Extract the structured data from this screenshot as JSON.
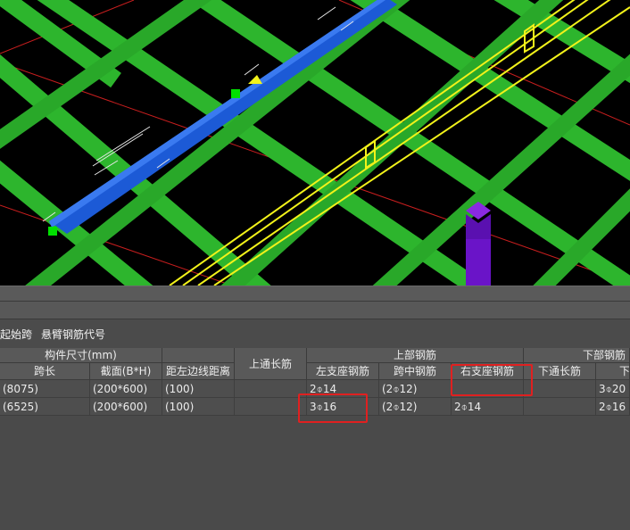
{
  "toolbar": {
    "start_span": "起始跨",
    "cantilever_code": "悬臂钢筋代号"
  },
  "table": {
    "group_member_size": "构件尺寸(mm)",
    "col_span": "跨长",
    "col_section": "截面(B*H)",
    "col_offset": "距左边线距离",
    "col_top_through": "上通长筋",
    "group_top": "上部钢筋",
    "col_left_support": "左支座钢筋",
    "col_mid_span": "跨中钢筋",
    "col_right_support": "右支座钢筋",
    "group_bottom": "下部钢筋",
    "col_bottom_through": "下通长筋",
    "col_bottom_next": "下",
    "rows": [
      {
        "span": "(8075)",
        "section": "(200*600)",
        "offset": "(100)",
        "top_through": "",
        "left_support": "2⌽14",
        "mid_span": "(2⌽12)",
        "right_support": "",
        "bottom_through": "",
        "bottom_next": "3⌽20"
      },
      {
        "span": "(6525)",
        "section": "(200*600)",
        "offset": "(100)",
        "top_through": "",
        "left_support": "3⌽16",
        "mid_span": "(2⌽12)",
        "right_support": "2⌽14",
        "bottom_through": "",
        "bottom_next": "2⌽16"
      }
    ]
  },
  "colors": {
    "slab_green": "#2db52d",
    "beam_blue": "#1c5ad6",
    "highlight_yellow": "#f2f21a",
    "column_purple": "#6a14c8",
    "axis_red": "#c81e1e",
    "marker_green": "#00e000",
    "highlight_box": "#e02020"
  }
}
